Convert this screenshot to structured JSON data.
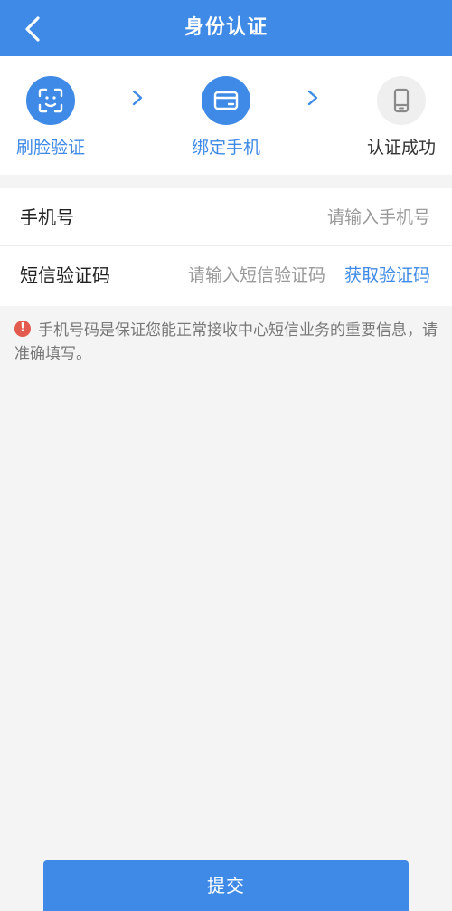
{
  "header": {
    "title": "身份认证",
    "back_icon": "chevron-left-icon"
  },
  "steps": [
    {
      "label": "刷脸验证",
      "icon": "face-scan-icon",
      "state": "active"
    },
    {
      "label": "绑定手机",
      "icon": "card-icon",
      "state": "active"
    },
    {
      "label": "认证成功",
      "icon": "phone-icon",
      "state": "inactive"
    }
  ],
  "form": {
    "phone": {
      "label": "手机号",
      "placeholder": "请输入手机号",
      "value": ""
    },
    "code": {
      "label": "短信验证码",
      "placeholder": "请输入短信验证码",
      "value": "",
      "get_code_label": "获取验证码"
    }
  },
  "notice": {
    "icon": "exclamation-circle-icon",
    "text": "手机号码是保证您能正常接收中心短信业务的重要信息，请准确填写。"
  },
  "submit": {
    "label": "提交"
  },
  "colors": {
    "primary": "#3f8ae6",
    "background": "#f4f4f4",
    "warning": "#e25b4e"
  }
}
